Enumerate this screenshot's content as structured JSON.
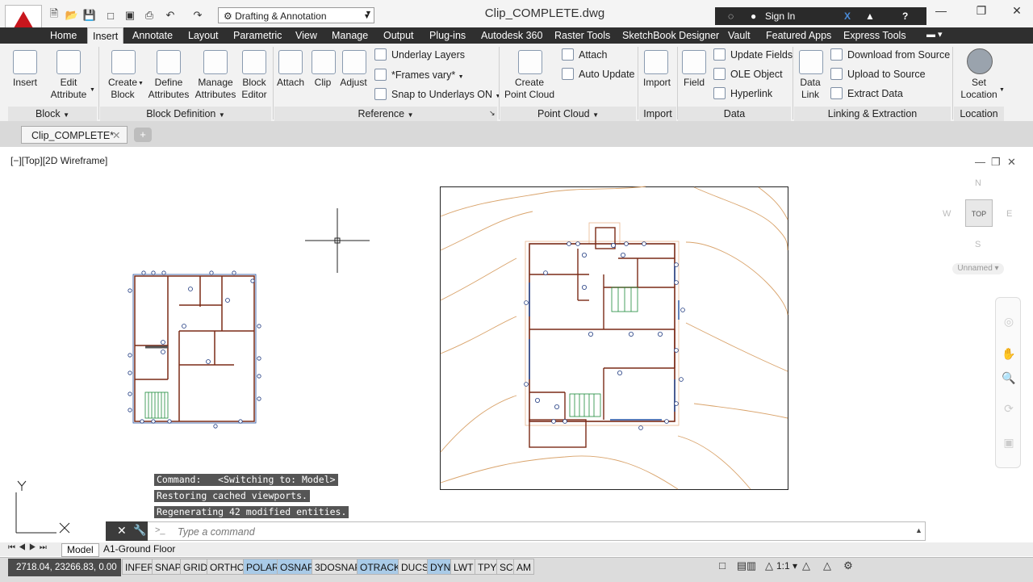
{
  "title_bar": {
    "workspace": "Drafting & Annotation",
    "document_title": "Clip_COMPLETE.dwg",
    "sign_in": "Sign In",
    "help": "?"
  },
  "tabs": [
    "Home",
    "Insert",
    "Annotate",
    "Layout",
    "Parametric",
    "View",
    "Manage",
    "Output",
    "Plug-ins",
    "Autodesk 360",
    "Raster Tools",
    "SketchBook Designer",
    "Vault",
    "Featured Apps",
    "Express Tools"
  ],
  "active_tab": "Insert",
  "ribbon": {
    "block": {
      "title": "Block",
      "insert": "Insert",
      "edit_attribute": "Edit\nAttribute"
    },
    "block_definition": {
      "title": "Block Definition",
      "create_block": "Create\nBlock",
      "define_attributes": "Define\nAttributes",
      "manage_attributes": "Manage\nAttributes",
      "block_editor": "Block\nEditor"
    },
    "reference": {
      "title": "Reference",
      "attach": "Attach",
      "clip": "Clip",
      "adjust": "Adjust",
      "underlay_layers": "Underlay Layers",
      "frames_vary": "*Frames vary*",
      "snap_to_underlays": "Snap to Underlays ON"
    },
    "point_cloud": {
      "title": "Point Cloud",
      "create_point_cloud": "Create\nPoint Cloud",
      "attach": "Attach",
      "auto_update": "Auto Update"
    },
    "import": {
      "title": "Import",
      "import": "Import"
    },
    "data": {
      "title": "Data",
      "field": "Field",
      "update_fields": "Update Fields",
      "ole_object": "OLE Object",
      "hyperlink": "Hyperlink"
    },
    "linking": {
      "title": "Linking & Extraction",
      "data_link": "Data\nLink",
      "download_from_source": "Download from Source",
      "upload_to_source": "Upload to Source",
      "extract_data": "Extract  Data"
    },
    "location": {
      "title": "Location",
      "set_location": "Set\nLocation"
    }
  },
  "document_tab": "Clip_COMPLETE*",
  "viewport_label": "[−][Top][2D Wireframe]",
  "viewcube": {
    "face": "TOP",
    "n": "N",
    "s": "S",
    "e": "E",
    "w": "W",
    "ucs": "Unnamed"
  },
  "command_history": [
    "Command:   <Switching to: Model>",
    "Restoring cached viewports.",
    "Regenerating 42 modified entities."
  ],
  "command_placeholder": "Type a command",
  "layout_tabs": [
    "Model",
    "A1-Ground Floor"
  ],
  "status_bar": {
    "coordinates": "2718.04, 23266.83, 0.00",
    "toggles": [
      {
        "label": "INFER",
        "on": false
      },
      {
        "label": "SNAP",
        "on": false
      },
      {
        "label": "GRID",
        "on": false
      },
      {
        "label": "ORTHO",
        "on": false
      },
      {
        "label": "POLAR",
        "on": true
      },
      {
        "label": "OSNAP",
        "on": true
      },
      {
        "label": "3DOSNAP",
        "on": false
      },
      {
        "label": "OTRACK",
        "on": true
      },
      {
        "label": "DUCS",
        "on": false
      },
      {
        "label": "DYN",
        "on": true
      },
      {
        "label": "LWT",
        "on": false
      },
      {
        "label": "TPY",
        "on": false
      },
      {
        "label": "SC",
        "on": false
      },
      {
        "label": "AM",
        "on": false
      }
    ],
    "annotation_scale": "1:1"
  },
  "colors": {
    "accent": "#c8161d",
    "toggle_on": "#a9cbe8",
    "contours": "#d9a36b",
    "walls": "#7a2a16",
    "blue_marks": "#1f4ea0",
    "stairs": "#1d8a3a"
  }
}
